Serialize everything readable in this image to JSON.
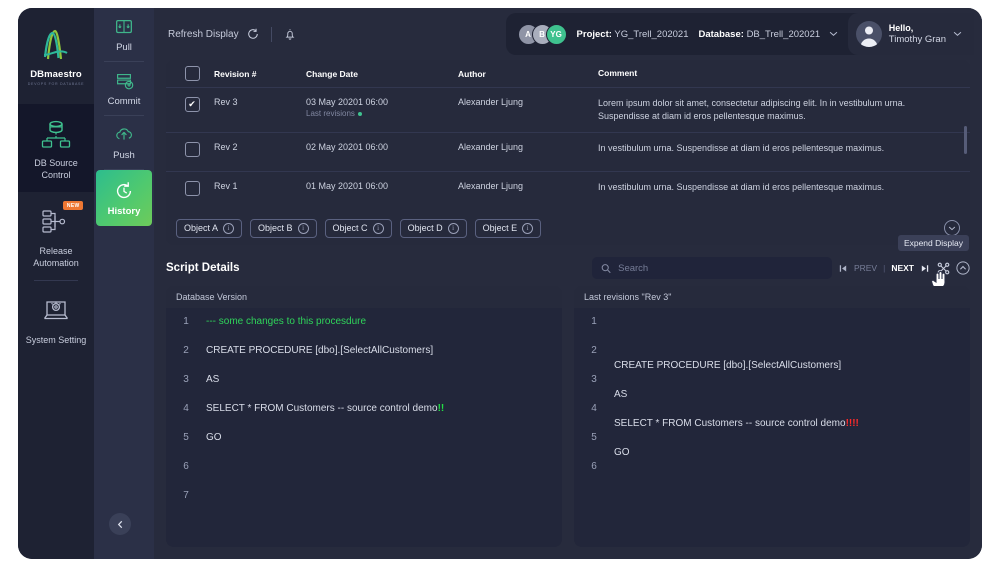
{
  "brand": {
    "name": "DBmaestro",
    "tagline": "DevOps for Database",
    "logo_icon": "dbmaestro-logo-icon"
  },
  "sidebar": {
    "items": [
      {
        "label": "DB Source Control",
        "icon": "database-source-control-icon",
        "active": true,
        "badge": ""
      },
      {
        "label": "Release Automation",
        "icon": "release-automation-icon",
        "active": false,
        "badge": "NEW"
      },
      {
        "label": "System Setting",
        "icon": "system-setting-icon",
        "active": false,
        "badge": ""
      }
    ],
    "collapse_icon": "chevron-left-icon"
  },
  "actions_rail": {
    "items": [
      {
        "label": "Pull",
        "icon": "pull-icon",
        "active": false
      },
      {
        "label": "Commit",
        "icon": "commit-icon",
        "active": false
      },
      {
        "label": "Push",
        "icon": "push-icon",
        "active": false
      },
      {
        "label": "History",
        "icon": "history-icon",
        "active": true
      }
    ],
    "active_color": "#4fc96f"
  },
  "topbar": {
    "refresh_label": "Refresh Display",
    "refresh_icon": "refresh-icon",
    "bell_icon": "bell-icon",
    "avatars": [
      {
        "initials": "A",
        "color": "#8f94a6"
      },
      {
        "initials": "B",
        "color": "#a9aebd"
      },
      {
        "initials": "YG",
        "color": "#3fc28f"
      }
    ],
    "project_label": "Project:",
    "project_value": "YG_Trell_202021",
    "database_label": "Database:",
    "database_value": "DB_Trell_202021",
    "database_caret_icon": "chevron-down-icon",
    "user_greeting": "Hello,",
    "user_name": "Timothy Gran",
    "user_caret_icon": "chevron-down-icon",
    "user_avatar_icon": "user-avatar-icon"
  },
  "revisions_table": {
    "columns": [
      "",
      "Revision #",
      "Change Date",
      "Author",
      "Comment"
    ],
    "rows": [
      {
        "checked": true,
        "revision": "Rev 3",
        "date": "03 May 20201 06:00",
        "date_sub": "Last revisions",
        "author": "Alexander Ljung",
        "comment": "Lorem ipsum dolor sit amet, consectetur adipiscing elit. In in vestibulum urna. Suspendisse at diam id eros pellentesque maximus."
      },
      {
        "checked": false,
        "revision": "Rev 2",
        "date": "02 May 20201 06:00",
        "date_sub": "",
        "author": "Alexander Ljung",
        "comment": "In vestibulum urna. Suspendisse at diam id eros pellentesque maximus."
      },
      {
        "checked": false,
        "revision": "Rev 1",
        "date": "01 May 20201 06:00",
        "date_sub": "",
        "author": "Alexander Ljung",
        "comment": "In vestibulum urna. Suspendisse at diam id eros pellentesque maximus."
      }
    ]
  },
  "object_chips": {
    "items": [
      "Object A",
      "Object B",
      "Object C",
      "Object D",
      "Object E"
    ],
    "info_icon": "info-icon",
    "expand_icon": "chevron-down-circle-icon"
  },
  "script_details": {
    "title": "Script Details",
    "search_placeholder": "Search",
    "search_value": "",
    "search_icon": "search-icon",
    "nav": {
      "first_icon": "skip-first-icon",
      "prev_label": "PREV",
      "separator": "|",
      "next_label": "NEXT",
      "last_icon": "skip-last-icon",
      "compare_icon": "compare-nodes-icon",
      "collapse_icon": "chevron-up-circle-icon"
    },
    "tooltip": "Expend Display",
    "cursor_icon": "hand-cursor-icon"
  },
  "left_panel": {
    "title": "Database Version",
    "lines": [
      {
        "n": "1",
        "text": "--- some changes to this procesdure",
        "style": "comment",
        "shift": false,
        "suffix": "",
        "suffix_style": ""
      },
      {
        "n": "2",
        "text": "CREATE PROCEDURE [dbo].[SelectAllCustomers]",
        "style": "",
        "shift": false,
        "suffix": "",
        "suffix_style": ""
      },
      {
        "n": "3",
        "text": "AS",
        "style": "",
        "shift": false,
        "suffix": "",
        "suffix_style": ""
      },
      {
        "n": "4",
        "text": "SELECT * FROM Customers -- source control demo",
        "style": "",
        "shift": false,
        "suffix": "!!",
        "suffix_style": "bang-green"
      },
      {
        "n": "5",
        "text": "GO",
        "style": "",
        "shift": false,
        "suffix": "",
        "suffix_style": ""
      },
      {
        "n": "6",
        "text": "",
        "style": "",
        "shift": false,
        "suffix": "",
        "suffix_style": ""
      },
      {
        "n": "7",
        "text": "",
        "style": "",
        "shift": false,
        "suffix": "",
        "suffix_style": ""
      }
    ]
  },
  "right_panel": {
    "title": "Last revisions \"Rev 3\"",
    "lines": [
      {
        "n": "1",
        "text": "",
        "style": "",
        "shift": true,
        "suffix": "",
        "suffix_style": ""
      },
      {
        "n": "2",
        "text": "CREATE PROCEDURE [dbo].[SelectAllCustomers]",
        "style": "",
        "shift": true,
        "suffix": "",
        "suffix_style": ""
      },
      {
        "n": "3",
        "text": "AS",
        "style": "",
        "shift": true,
        "suffix": "",
        "suffix_style": ""
      },
      {
        "n": "4",
        "text": "SELECT * FROM Customers -- source control demo",
        "style": "",
        "shift": true,
        "suffix": "!!!!",
        "suffix_style": "bang-red"
      },
      {
        "n": "5",
        "text": "GO",
        "style": "",
        "shift": true,
        "suffix": "",
        "suffix_style": ""
      },
      {
        "n": "6",
        "text": "",
        "style": "",
        "shift": true,
        "suffix": "",
        "suffix_style": ""
      }
    ]
  }
}
